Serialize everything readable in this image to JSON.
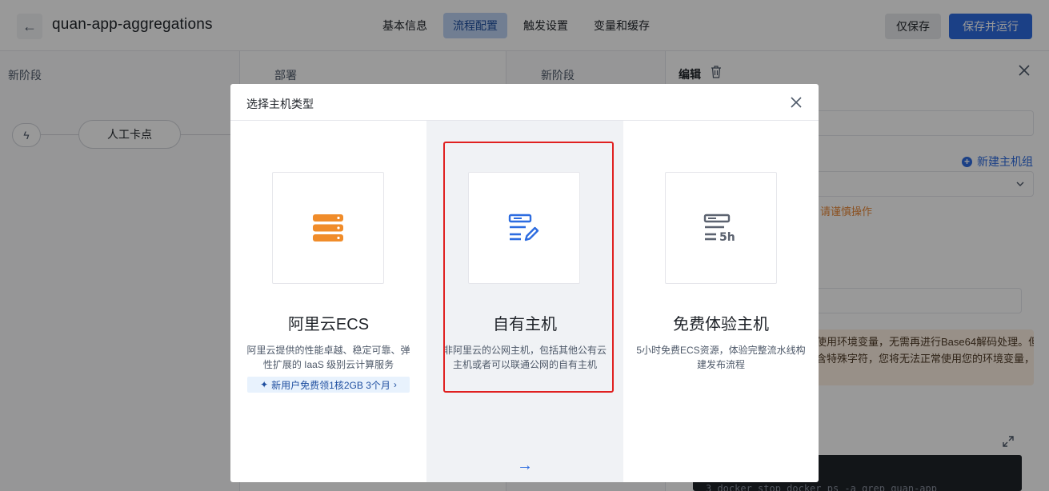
{
  "header": {
    "back_icon": "←",
    "app_title": "quan-app-aggregations",
    "tabs": [
      {
        "label": "基本信息",
        "active": false
      },
      {
        "label": "流程配置",
        "active": true
      },
      {
        "label": "触发设置",
        "active": false
      },
      {
        "label": "变量和缓存",
        "active": false
      }
    ],
    "save_label": "仅保存",
    "save_run_label": "保存并运行"
  },
  "pipeline": {
    "stage1_label": "新阶段",
    "stage2_label": "部署",
    "stage3_label": "新阶段",
    "manual_node_label": "人工卡点",
    "trigger_icon": "ϟ"
  },
  "edit_panel": {
    "title": "编辑",
    "new_group_label": "新建主机组",
    "warning_text": "，请谨慎操作",
    "notice_lines": [
      "使用环境变量，无需再进行Base64解码处理。但",
      "含特殊字符，您将无法正常使用您的环境变量，"
    ],
    "code_line": "3  docker stop  docker ps  -a  grep quan-app"
  },
  "modal": {
    "title": "选择主机类型",
    "options": [
      {
        "title": "阿里云ECS",
        "desc": "阿里云提供的性能卓越、稳定可靠、弹性扩展的 IaaS 级别云计算服务",
        "promo": "新用户免费领1核2GB 3个月",
        "promo_arrow": "›",
        "icon": "server-stack-icon",
        "color": "#f08c2a"
      },
      {
        "title": "自有主机",
        "desc": "非阿里云的公网主机，包括其他公有云主机或者可以联通公网的自有主机",
        "icon": "server-edit-icon",
        "color": "#2d6ce0",
        "selected": true,
        "next_arrow": "→"
      },
      {
        "title": "免费体验主机",
        "desc": "5小时免费ECS资源，体验完整流水线构建发布流程",
        "icon": "server-5h-icon",
        "icon_text": "5h",
        "color": "#5c6370"
      }
    ]
  }
}
